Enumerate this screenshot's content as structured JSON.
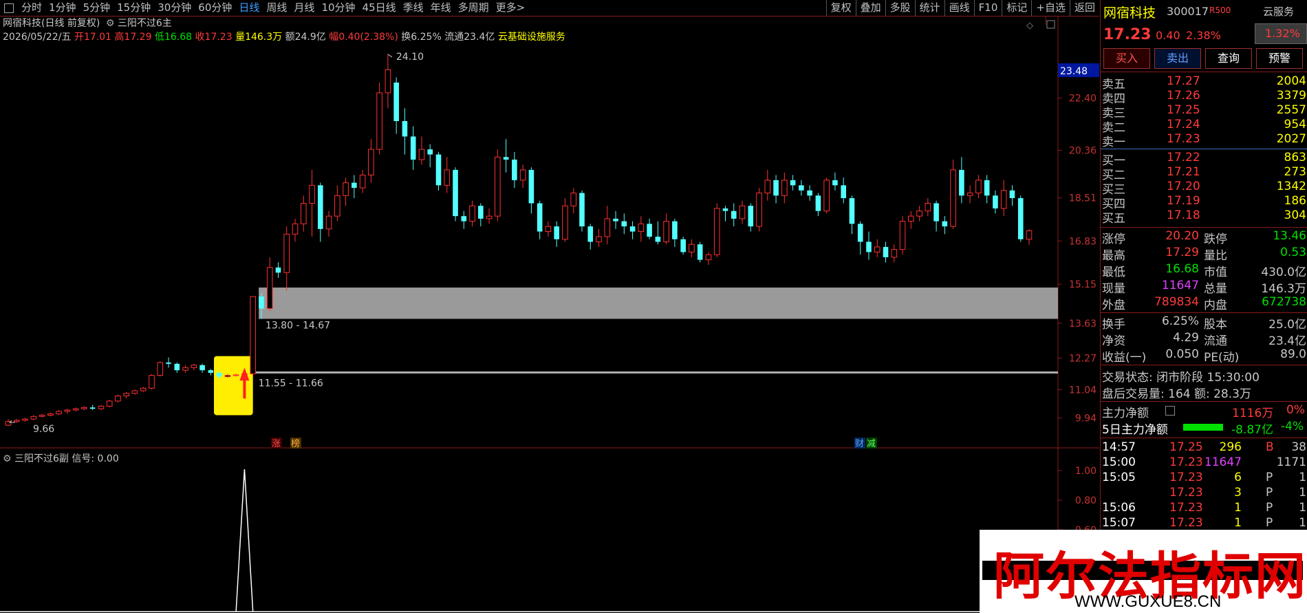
{
  "toolbar": {
    "periods": [
      "分时",
      "1分钟",
      "5分钟",
      "15分钟",
      "30分钟",
      "60分钟",
      "日线",
      "周线",
      "月线",
      "10分钟",
      "45日线",
      "季线",
      "年线",
      "多周期",
      "更多>"
    ],
    "active_period": "日线",
    "right_buttons": [
      "复权",
      "叠加",
      "多股",
      "统计",
      "画线",
      "F10",
      "标记",
      "+自选",
      "返回"
    ]
  },
  "chart_header": {
    "title": "网宿科技(日线 前复权)",
    "indicator": "三阳不过6主",
    "date": "2026/05/22/五",
    "open_label": "开",
    "open": "17.01",
    "high_label": "高",
    "high": "17.29",
    "low_label": "低",
    "low": "16.68",
    "close_label": "收",
    "close": "17.23",
    "vol_label": "量",
    "vol": "146.3万",
    "amount_label": "额",
    "amount": "24.9亿",
    "amp_label": "幅",
    "amp": "0.40(2.38%)",
    "turnover_label": "换",
    "turnover": "6.25%",
    "float_label": "流通",
    "float": "23.4亿",
    "sector": "云基础设施服务"
  },
  "price_axis": {
    "ticks": [
      "22.40",
      "20.36",
      "18.51",
      "16.83",
      "15.15",
      "13.63",
      "12.27",
      "11.04",
      "9.94"
    ],
    "current": "23.48",
    "sub_ticks": [
      "1.00",
      "0.80",
      "0.60"
    ]
  },
  "annotations": {
    "peak": "24.10",
    "low": "9.66",
    "zone_upper": "13.80 - 14.67",
    "zone_lower": "11.55 - 11.66",
    "tag_zhang": "涨",
    "tag_bang": "榜",
    "tag_cai": "财",
    "tag_jian": "减"
  },
  "sub_chart": {
    "title": "三阳不过6副",
    "signal_label": "信号: 0.00"
  },
  "chart_data": {
    "type": "candlestick",
    "y_range": [
      9.5,
      24.5
    ],
    "candles": [
      [
        9.66,
        9.8,
        9.62,
        9.9
      ],
      [
        9.8,
        9.85,
        9.75,
        9.9
      ],
      [
        9.85,
        9.9,
        9.8,
        9.95
      ],
      [
        9.9,
        10.0,
        9.85,
        10.05
      ],
      [
        10.0,
        10.05,
        9.95,
        10.1
      ],
      [
        10.05,
        10.1,
        10.0,
        10.15
      ],
      [
        10.1,
        10.2,
        10.05,
        10.25
      ],
      [
        10.2,
        10.25,
        10.1,
        10.3
      ],
      [
        10.25,
        10.3,
        10.2,
        10.35
      ],
      [
        10.3,
        10.35,
        10.25,
        10.4
      ],
      [
        10.35,
        10.3,
        10.25,
        10.45
      ],
      [
        10.3,
        10.4,
        10.25,
        10.45
      ],
      [
        10.4,
        10.6,
        10.35,
        10.65
      ],
      [
        10.6,
        10.8,
        10.55,
        10.85
      ],
      [
        10.8,
        10.9,
        10.7,
        10.95
      ],
      [
        10.9,
        11.0,
        10.85,
        11.05
      ],
      [
        11.0,
        11.1,
        10.95,
        11.15
      ],
      [
        11.1,
        11.6,
        11.05,
        11.65
      ],
      [
        11.6,
        12.1,
        11.55,
        12.15
      ],
      [
        12.1,
        12.05,
        11.9,
        12.3
      ],
      [
        12.05,
        11.8,
        11.7,
        12.1
      ],
      [
        11.8,
        11.9,
        11.7,
        12.0
      ],
      [
        11.9,
        12.0,
        11.8,
        12.05
      ],
      [
        12.0,
        11.8,
        11.7,
        12.05
      ],
      [
        11.8,
        11.7,
        11.6,
        11.85
      ],
      [
        11.7,
        11.55,
        11.45,
        11.75
      ],
      [
        11.55,
        11.6,
        11.5,
        11.66
      ],
      [
        11.6,
        11.62,
        11.55,
        11.66
      ],
      [
        11.62,
        11.66,
        11.55,
        11.7
      ],
      [
        11.66,
        14.67,
        11.6,
        14.67
      ],
      [
        14.67,
        14.2,
        13.8,
        14.8
      ],
      [
        14.2,
        15.8,
        14.1,
        16.2
      ],
      [
        15.8,
        15.6,
        15.4,
        16.0
      ],
      [
        15.6,
        17.1,
        14.9,
        17.4
      ],
      [
        17.1,
        17.5,
        16.8,
        17.7
      ],
      [
        17.5,
        18.3,
        17.2,
        18.6
      ],
      [
        18.3,
        19.0,
        17.0,
        19.6
      ],
      [
        19.0,
        17.3,
        16.8,
        19.1
      ],
      [
        17.3,
        17.8,
        17.0,
        18.0
      ],
      [
        17.8,
        18.6,
        17.6,
        19.0
      ],
      [
        18.6,
        19.1,
        18.2,
        19.3
      ],
      [
        19.1,
        18.9,
        18.5,
        19.4
      ],
      [
        18.9,
        19.4,
        18.7,
        19.6
      ],
      [
        19.4,
        20.4,
        19.1,
        20.8
      ],
      [
        20.4,
        22.6,
        20.2,
        23.0
      ],
      [
        22.6,
        23.5,
        22.0,
        24.1
      ],
      [
        23.0,
        21.5,
        21.0,
        23.2
      ],
      [
        21.5,
        20.9,
        20.2,
        22.0
      ],
      [
        20.9,
        20.0,
        19.6,
        21.3
      ],
      [
        20.0,
        20.4,
        19.8,
        20.9
      ],
      [
        20.4,
        20.2,
        19.7,
        20.6
      ],
      [
        20.2,
        19.0,
        18.8,
        20.3
      ],
      [
        19.0,
        19.6,
        18.7,
        20.1
      ],
      [
        19.6,
        17.8,
        17.6,
        19.7
      ],
      [
        17.8,
        17.6,
        17.3,
        18.0
      ],
      [
        17.6,
        18.2,
        17.4,
        18.4
      ],
      [
        18.2,
        17.7,
        17.4,
        18.3
      ],
      [
        17.7,
        17.8,
        17.5,
        18.1
      ],
      [
        17.8,
        20.1,
        17.6,
        20.4
      ],
      [
        20.1,
        20.0,
        19.5,
        20.8
      ],
      [
        20.0,
        19.2,
        18.9,
        20.3
      ],
      [
        19.2,
        19.6,
        18.9,
        19.8
      ],
      [
        19.6,
        18.3,
        17.9,
        19.7
      ],
      [
        18.3,
        17.2,
        16.9,
        18.4
      ],
      [
        17.2,
        17.4,
        17.0,
        17.6
      ],
      [
        17.4,
        16.9,
        16.6,
        17.6
      ],
      [
        16.9,
        18.2,
        16.8,
        18.5
      ],
      [
        18.2,
        18.7,
        17.9,
        18.9
      ],
      [
        18.7,
        17.4,
        17.2,
        18.8
      ],
      [
        17.4,
        16.8,
        16.5,
        17.5
      ],
      [
        16.8,
        17.0,
        16.6,
        17.3
      ],
      [
        17.0,
        17.7,
        16.7,
        18.2
      ],
      [
        17.7,
        17.6,
        17.3,
        18.0
      ],
      [
        17.6,
        17.4,
        17.1,
        17.9
      ],
      [
        17.4,
        17.2,
        16.9,
        17.6
      ],
      [
        17.2,
        17.5,
        16.8,
        17.8
      ],
      [
        17.5,
        17.0,
        16.9,
        17.7
      ],
      [
        17.0,
        16.8,
        16.7,
        17.6
      ],
      [
        16.8,
        17.6,
        16.7,
        17.9
      ],
      [
        17.6,
        16.9,
        16.6,
        17.7
      ],
      [
        16.9,
        16.4,
        16.3,
        17.0
      ],
      [
        16.4,
        16.7,
        16.2,
        16.9
      ],
      [
        16.7,
        16.1,
        16.0,
        16.8
      ],
      [
        16.1,
        16.3,
        15.9,
        16.4
      ],
      [
        16.3,
        18.1,
        16.2,
        18.3
      ],
      [
        18.1,
        18.0,
        17.6,
        18.2
      ],
      [
        18.0,
        17.7,
        17.4,
        18.3
      ],
      [
        17.7,
        18.2,
        17.5,
        18.4
      ],
      [
        18.2,
        17.4,
        17.2,
        18.3
      ],
      [
        17.4,
        18.7,
        17.2,
        18.9
      ],
      [
        18.7,
        19.2,
        18.4,
        19.6
      ],
      [
        19.2,
        18.6,
        18.3,
        19.4
      ],
      [
        18.6,
        19.2,
        18.3,
        19.5
      ],
      [
        19.2,
        19.0,
        18.8,
        19.4
      ],
      [
        19.0,
        18.8,
        18.6,
        19.2
      ],
      [
        18.8,
        18.6,
        18.4,
        19.0
      ],
      [
        18.6,
        18.0,
        17.8,
        18.7
      ],
      [
        18.0,
        19.2,
        17.9,
        19.3
      ],
      [
        19.2,
        19.0,
        18.8,
        19.5
      ],
      [
        19.0,
        18.5,
        18.3,
        19.3
      ],
      [
        18.5,
        17.5,
        17.1,
        18.6
      ],
      [
        17.5,
        16.8,
        16.3,
        17.6
      ],
      [
        16.8,
        16.4,
        16.1,
        17.2
      ],
      [
        16.4,
        16.6,
        16.2,
        16.9
      ],
      [
        16.6,
        16.2,
        16.0,
        16.8
      ],
      [
        16.2,
        16.5,
        16.0,
        16.7
      ],
      [
        16.5,
        17.6,
        16.3,
        17.8
      ],
      [
        17.6,
        17.8,
        17.3,
        18.0
      ],
      [
        17.8,
        18.0,
        17.6,
        18.2
      ],
      [
        18.0,
        18.3,
        17.8,
        18.5
      ],
      [
        18.3,
        17.6,
        17.2,
        18.4
      ],
      [
        17.6,
        17.4,
        17.1,
        17.8
      ],
      [
        17.4,
        19.6,
        17.3,
        20.0
      ],
      [
        19.6,
        18.6,
        18.3,
        20.1
      ],
      [
        18.6,
        18.7,
        18.3,
        19.0
      ],
      [
        18.7,
        19.2,
        18.5,
        19.4
      ],
      [
        19.2,
        18.6,
        18.3,
        19.4
      ],
      [
        18.6,
        18.1,
        17.9,
        18.8
      ],
      [
        18.1,
        18.8,
        17.8,
        19.2
      ],
      [
        18.8,
        18.5,
        18.2,
        19.0
      ],
      [
        18.5,
        16.9,
        16.8,
        18.6
      ],
      [
        16.9,
        17.23,
        16.68,
        17.29
      ]
    ],
    "zone_upper": [
      13.8,
      14.67
    ],
    "zone_lower": [
      11.55,
      11.66
    ],
    "signal_index": 29,
    "signal_values": [
      0,
      1,
      0
    ]
  },
  "quote": {
    "name": "网宿科技",
    "code": "300017",
    "tag": "R500",
    "cloud": "云服务",
    "cloud_pct": "1.32%",
    "price": "17.23",
    "change": "0.40",
    "change_pct": "2.38%",
    "buttons": [
      "买入",
      "卖出",
      "查询",
      "预警"
    ],
    "sell": [
      {
        "label": "卖五",
        "price": "17.27",
        "vol": "2004"
      },
      {
        "label": "卖四",
        "price": "17.26",
        "vol": "3379"
      },
      {
        "label": "卖三",
        "price": "17.25",
        "vol": "2557"
      },
      {
        "label": "卖二",
        "price": "17.24",
        "vol": "954"
      },
      {
        "label": "卖一",
        "price": "17.23",
        "vol": "2027"
      }
    ],
    "buy": [
      {
        "label": "买一",
        "price": "17.22",
        "vol": "863"
      },
      {
        "label": "买二",
        "price": "17.21",
        "vol": "273"
      },
      {
        "label": "买三",
        "price": "17.20",
        "vol": "1342"
      },
      {
        "label": "买四",
        "price": "17.19",
        "vol": "186"
      },
      {
        "label": "买五",
        "price": "17.18",
        "vol": "304"
      }
    ],
    "stats": [
      {
        "l1": "涨停",
        "v1": "20.20",
        "l2": "跌停",
        "v2": "13.46"
      },
      {
        "l1": "最高",
        "v1": "17.29",
        "l2": "量比",
        "v2": "0.53"
      },
      {
        "l1": "最低",
        "v1": "16.68",
        "l2": "市值",
        "v2": "430.0亿"
      },
      {
        "l1": "现量",
        "v1": "11647",
        "l2": "总量",
        "v2": "146.3万"
      },
      {
        "l1": "外盘",
        "v1": "789834",
        "l2": "内盘",
        "v2": "672738"
      }
    ],
    "stats2": [
      {
        "l1": "换手",
        "v1": "6.25%",
        "l2": "股本",
        "v2": "25.0亿"
      },
      {
        "l1": "净资",
        "v1": "4.29",
        "l2": "流通",
        "v2": "23.4亿"
      },
      {
        "l1": "收益(一)",
        "v1": "0.050",
        "l2": "PE(动)",
        "v2": "89.0"
      }
    ],
    "trade_status": "交易状态: 闭市阶段  15:30:00",
    "after_hours": "盘后交易量: 164  额: 28.3万",
    "main_net_label": "主力净额",
    "main_net": "1116万",
    "main_net_pct": "0%",
    "five_day_label": "5日主力净额",
    "five_day": "-8.87亿",
    "five_day_pct": "-4%",
    "ticks": [
      {
        "time": "14:57",
        "price": "17.25",
        "vol": "296",
        "dir": "B",
        "n": "38"
      },
      {
        "time": "15:00",
        "price": "17.23",
        "vol": "11647",
        "dir": "",
        "n": "1171"
      },
      {
        "time": "15:05",
        "price": "17.23",
        "vol": "6",
        "dir": "P",
        "n": "1"
      },
      {
        "time": "",
        "price": "17.23",
        "vol": "3",
        "dir": "P",
        "n": "1"
      },
      {
        "time": "15:06",
        "price": "17.23",
        "vol": "1",
        "dir": "P",
        "n": "1"
      },
      {
        "time": "15:07",
        "price": "17.23",
        "vol": "1",
        "dir": "P",
        "n": "1"
      }
    ]
  },
  "watermark": {
    "main": "阿尔法指标网",
    "url": "WWW.GUXUE8.CN"
  }
}
